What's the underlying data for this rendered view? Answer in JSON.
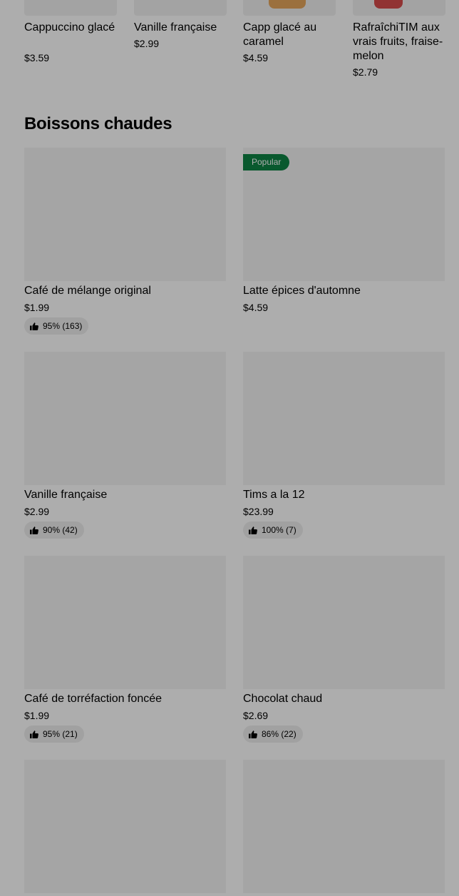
{
  "carousel": {
    "items": [
      {
        "title": "Cappuccino glacé",
        "price": "$3.59"
      },
      {
        "title": "Vanille française",
        "price": "$2.99"
      },
      {
        "title": "Capp glacé au caramel",
        "price": "$4.59"
      },
      {
        "title": "RafraîchiTIM aux vrais fruits, fraise-melon",
        "price": "$2.79"
      }
    ]
  },
  "section": {
    "title": "Boissons chaudes"
  },
  "items": [
    {
      "name": "Café de mélange original",
      "price": "$1.99",
      "rating": "95% (163)"
    },
    {
      "name": "Latte épices d'automne",
      "price": "$4.59",
      "badge": "Popular"
    },
    {
      "name": "Vanille française",
      "price": "$2.99",
      "rating": "90% (42)"
    },
    {
      "name": "Tims a la 12",
      "price": "$23.99",
      "rating": "100% (7)"
    },
    {
      "name": "Café de torréfaction foncée",
      "price": "$1.99",
      "rating": "95% (21)"
    },
    {
      "name": "Chocolat chaud",
      "price": "$2.69",
      "rating": "86% (22)"
    }
  ],
  "colors": {
    "popular_badge": "#0e8345",
    "overlay": "rgba(0,0,0,0.32)"
  },
  "icons": {
    "rating": "thumbs-up-icon"
  }
}
